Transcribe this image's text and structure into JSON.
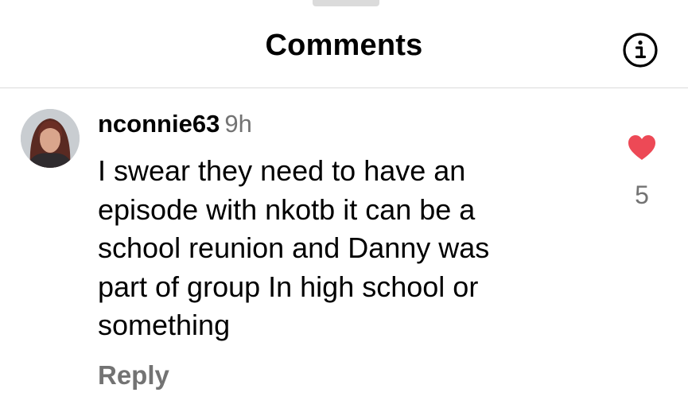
{
  "header": {
    "title": "Comments",
    "info_icon": "info-circle-icon"
  },
  "comment": {
    "username": "nconnie63",
    "time": "9h",
    "text": "I swear they need to have an\nepisode with nkotb it can be a\nschool reunion and Danny was\npart of group In high school  or\nsomething",
    "reply_label": "Reply",
    "like_count": "5",
    "like_icon": "heart-filled-icon",
    "like_color": "#ed4956",
    "liked": true
  },
  "colors": {
    "secondary_text": "#737373",
    "divider": "#dbdbdb"
  }
}
